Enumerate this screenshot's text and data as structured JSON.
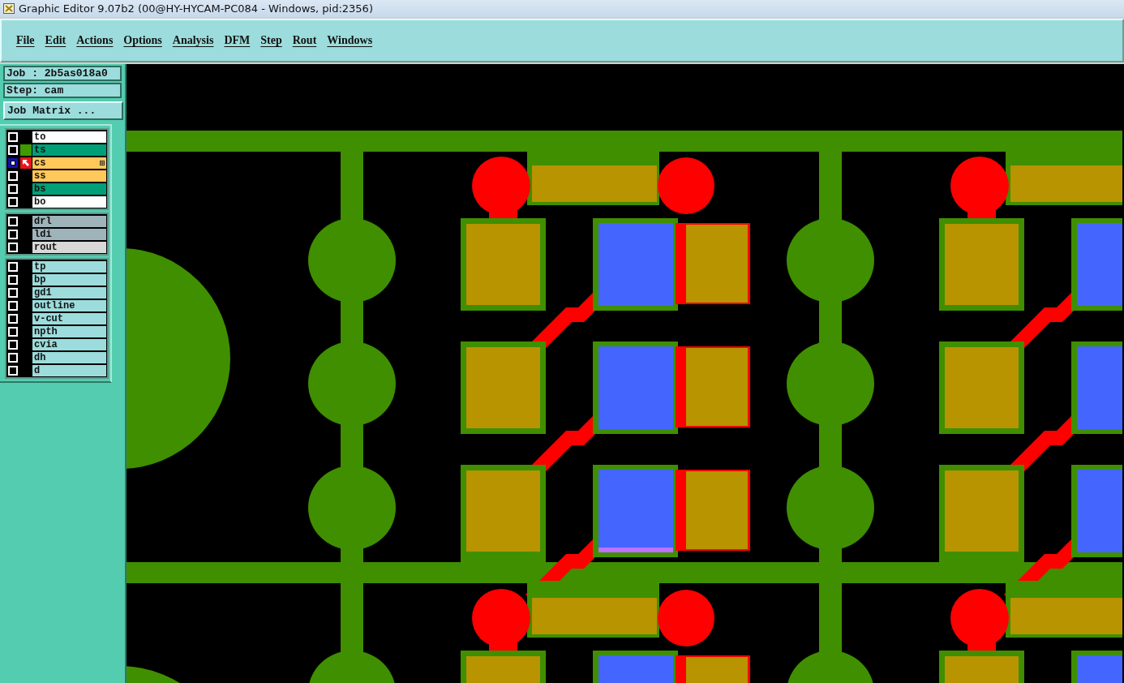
{
  "window": {
    "title": "Graphic Editor 9.07b2 (00@HY-HYCAM-PC084 - Windows, pid:2356)"
  },
  "menu": [
    "File",
    "Edit",
    "Actions",
    "Options",
    "Analysis",
    "DFM",
    "Step",
    "Rout",
    "Windows"
  ],
  "job": "Job : 2b5as018a0",
  "step": "Step: cam",
  "job_matrix_button": "Job Matrix ...",
  "layer_groups": [
    {
      "layers": [
        {
          "name": "to",
          "color": "#ffffff",
          "selected": false,
          "displayed": false,
          "work": false
        },
        {
          "name": "ts",
          "color": "#009f78",
          "selected": false,
          "displayed": true,
          "work": false
        },
        {
          "name": "cs",
          "color": "#ffc85a",
          "selected": true,
          "displayed": false,
          "work": true
        },
        {
          "name": "ss",
          "color": "#ffc85a",
          "selected": false,
          "displayed": false,
          "work": false
        },
        {
          "name": "bs",
          "color": "#009f78",
          "selected": false,
          "displayed": false,
          "work": false
        },
        {
          "name": "bo",
          "color": "#ffffff",
          "selected": false,
          "displayed": false,
          "work": false
        }
      ]
    },
    {
      "layers": [
        {
          "name": "drl",
          "color": "#9fb4ba",
          "selected": false,
          "displayed": false,
          "work": false
        },
        {
          "name": "ldi",
          "color": "#9fb4ba",
          "selected": false,
          "displayed": false,
          "work": false
        },
        {
          "name": "rout",
          "color": "#d8d8d8",
          "selected": false,
          "displayed": false,
          "work": false
        }
      ]
    },
    {
      "layers": [
        {
          "name": "tp",
          "color": "#9cdcdc",
          "selected": false,
          "displayed": false,
          "work": false
        },
        {
          "name": "bp",
          "color": "#9cdcdc",
          "selected": false,
          "displayed": false,
          "work": false
        },
        {
          "name": "gd1",
          "color": "#9cdcdc",
          "selected": false,
          "displayed": false,
          "work": false
        },
        {
          "name": "outline",
          "color": "#9cdcdc",
          "selected": false,
          "displayed": false,
          "work": false
        },
        {
          "name": "v-cut",
          "color": "#9cdcdc",
          "selected": false,
          "displayed": false,
          "work": false
        },
        {
          "name": "npth",
          "color": "#9cdcdc",
          "selected": false,
          "displayed": false,
          "work": false
        },
        {
          "name": "cvia",
          "color": "#9cdcdc",
          "selected": false,
          "displayed": false,
          "work": false
        },
        {
          "name": "dh",
          "color": "#9cdcdc",
          "selected": false,
          "displayed": false,
          "work": false
        },
        {
          "name": "d",
          "color": "#9cdcdc",
          "selected": false,
          "displayed": false,
          "work": false
        }
      ]
    }
  ]
}
